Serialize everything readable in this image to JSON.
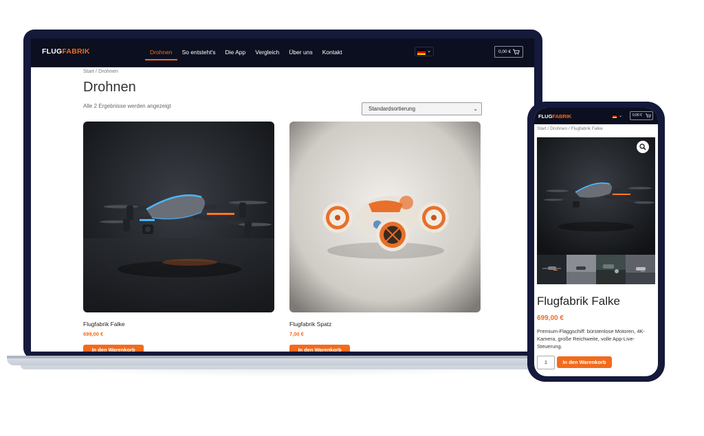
{
  "brand": {
    "logo_main": "FLUG",
    "logo_accent": "FABRIK",
    "accent_color": "#f26b1d",
    "header_color": "#0b0f1f",
    "frame_color": "#15193a"
  },
  "desktop": {
    "nav": [
      {
        "label": "Drohnen",
        "active": true
      },
      {
        "label": "So entsteht's",
        "active": false
      },
      {
        "label": "Die App",
        "active": false
      },
      {
        "label": "Vergleich",
        "active": false
      },
      {
        "label": "Über uns",
        "active": false
      },
      {
        "label": "Kontakt",
        "active": false
      }
    ],
    "language_flag": "germany-flag-icon",
    "cart_total": "0,00 €",
    "breadcrumb": "Start / Drohnen",
    "page_title": "Drohnen",
    "result_count": "Alle 2 Ergebnisse werden angezeigt",
    "sort_selected": "Standardsortierung",
    "products": [
      {
        "name": "Flugfabrik Falke",
        "price": "699,00 €",
        "button": "In den Warenkorb"
      },
      {
        "name": "Flugfabrik Spatz",
        "price": "7,00 €",
        "button": "In den Warenkorb"
      }
    ]
  },
  "mobile": {
    "cart_total": "0,00 €",
    "breadcrumb": "Start / Drohnen / Flugfabrik Falke",
    "product_title": "Flugfabrik Falke",
    "price": "699,00 €",
    "description": "Premium-Flaggschiff: bürstenlose Motoren, 4K-Kamera, große Reichweite, volle App-Live-Steuerung.",
    "quantity": "1",
    "button": "In den Warenkorb",
    "zoom_icon": "magnifier-icon"
  }
}
